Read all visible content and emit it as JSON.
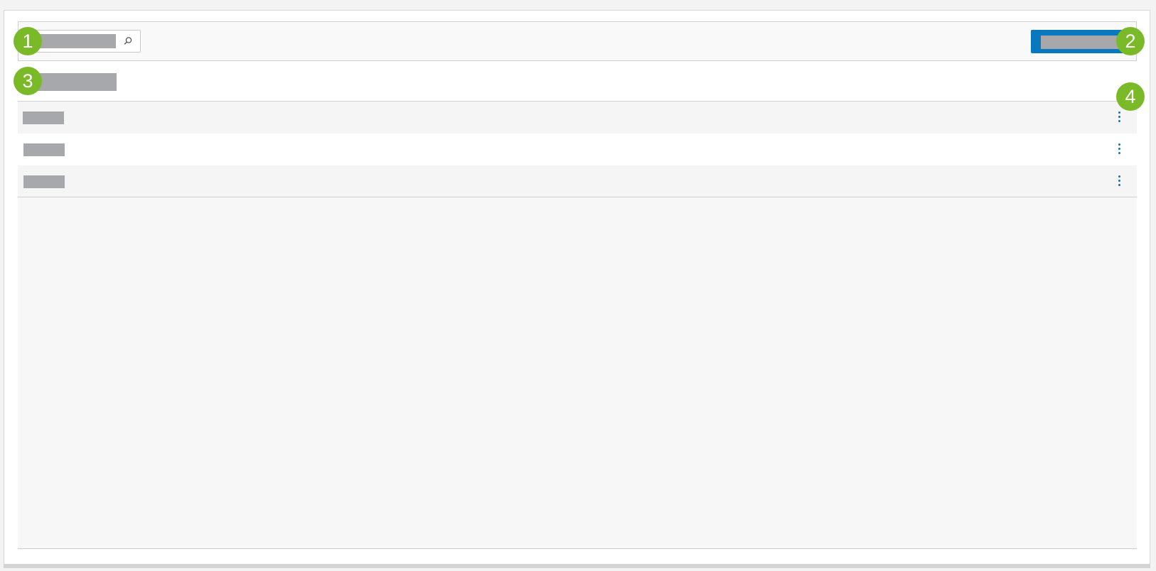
{
  "toolbar": {
    "search": {
      "placeholder": "",
      "value": "",
      "icon": "search-icon"
    },
    "primary_button_label": ""
  },
  "section": {
    "title": ""
  },
  "rows": [
    {
      "label": "",
      "menu_icon": "kebab-menu-icon"
    },
    {
      "label": "",
      "menu_icon": "kebab-menu-icon"
    },
    {
      "label": "",
      "menu_icon": "kebab-menu-icon"
    }
  ],
  "callouts": [
    "1",
    "2",
    "3",
    "4"
  ],
  "colors": {
    "accent": "#0a78be",
    "callout": "#7ab928",
    "redaction": "#a7a8ab",
    "panel": "#f7f7f7"
  }
}
